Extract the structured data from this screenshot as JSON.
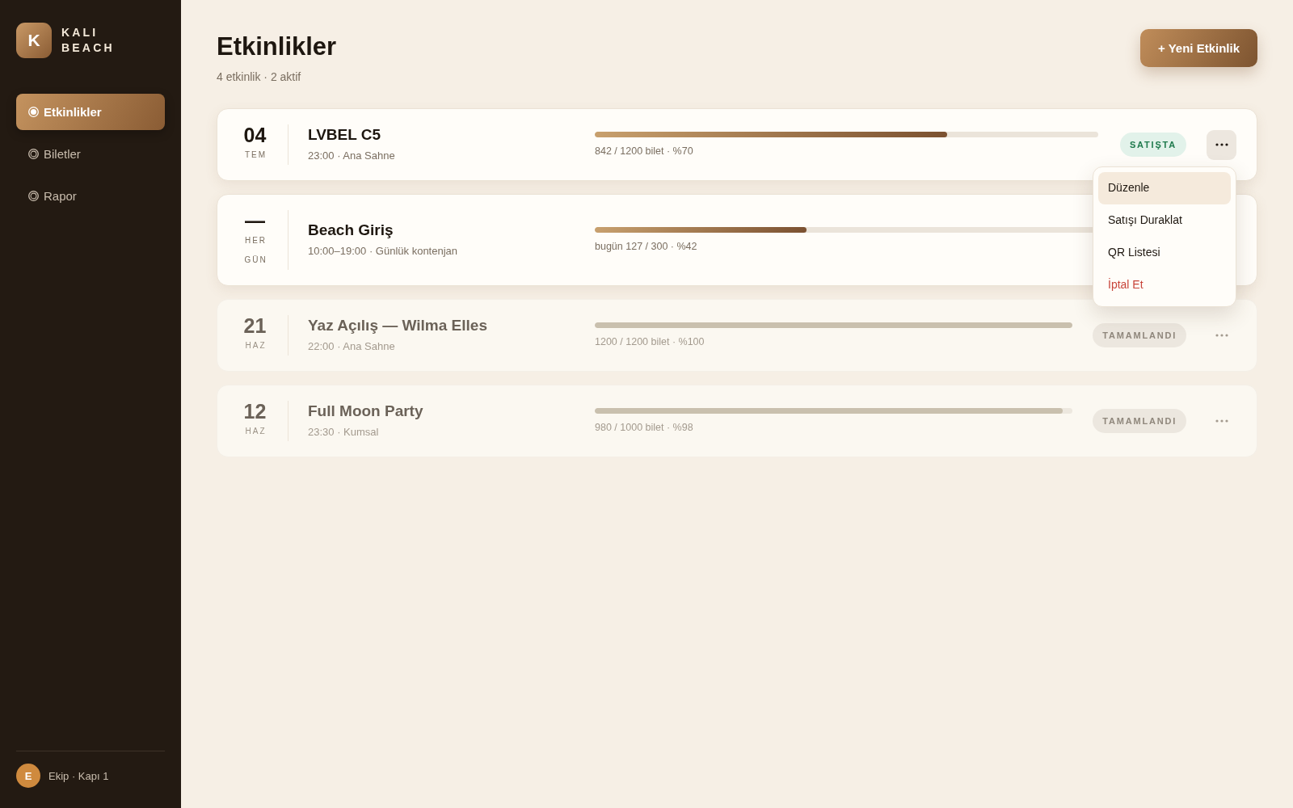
{
  "sidebar": {
    "brand": {
      "logo_letter": "K",
      "name": "KALI BEACH"
    },
    "nav": [
      {
        "label": "Etkinlikler",
        "selected": true
      },
      {
        "label": "Biletler",
        "selected": false
      },
      {
        "label": "Rapor",
        "selected": false
      }
    ],
    "user": {
      "initial": "E",
      "name": "Ekip · Kapı 1"
    }
  },
  "header": {
    "title": "Etkinlikler",
    "subtitle": "4 etkinlik · 2 aktif",
    "new_button": "+ Yeni Etkinlik"
  },
  "events": [
    {
      "day": "04",
      "month": "TEM",
      "title": "LVBEL C5",
      "details": "23:00 · Ana Sahne",
      "level": 0.7,
      "sales": "842 / 1200 bilet · %70",
      "past": false,
      "status": {
        "kind": "on_sale",
        "label": "SATIŞTA"
      },
      "more_menu": {
        "open": true,
        "items": [
          {
            "label": "Düzenle",
            "kind": "normal",
            "selected": true
          },
          {
            "label": "Satışı Duraklat",
            "kind": "normal",
            "selected": false
          },
          {
            "label": "QR Listesi",
            "kind": "normal",
            "selected": false
          },
          {
            "label": "İptal Et",
            "kind": "danger",
            "selected": false
          }
        ]
      }
    },
    {
      "day": "—",
      "month": "HER GÜN",
      "title": "Beach Giriş",
      "details": "10:00–19:00 · Günlük kontenjan",
      "level": 0.42,
      "sales": "bugün 127 / 300 · %42",
      "past": false
    },
    {
      "day": "21",
      "month": "HAZ",
      "title": "Yaz Açılış — Wilma Elles",
      "details": "22:00 · Ana Sahne",
      "level": 1.0,
      "sales": "1200 / 1200 bilet · %100",
      "past": true,
      "status": {
        "kind": "completed",
        "label": "TAMAMLANDI"
      },
      "more_menu": {
        "open": false
      }
    },
    {
      "day": "12",
      "month": "HAZ",
      "title": "Full Moon Party",
      "details": "23:30 · Kumsal",
      "level": 0.98,
      "sales": "980 / 1000 bilet · %98",
      "past": true,
      "status": {
        "kind": "completed",
        "label": "TAMAMLANDI"
      },
      "more_menu": {
        "open": false
      }
    }
  ]
}
